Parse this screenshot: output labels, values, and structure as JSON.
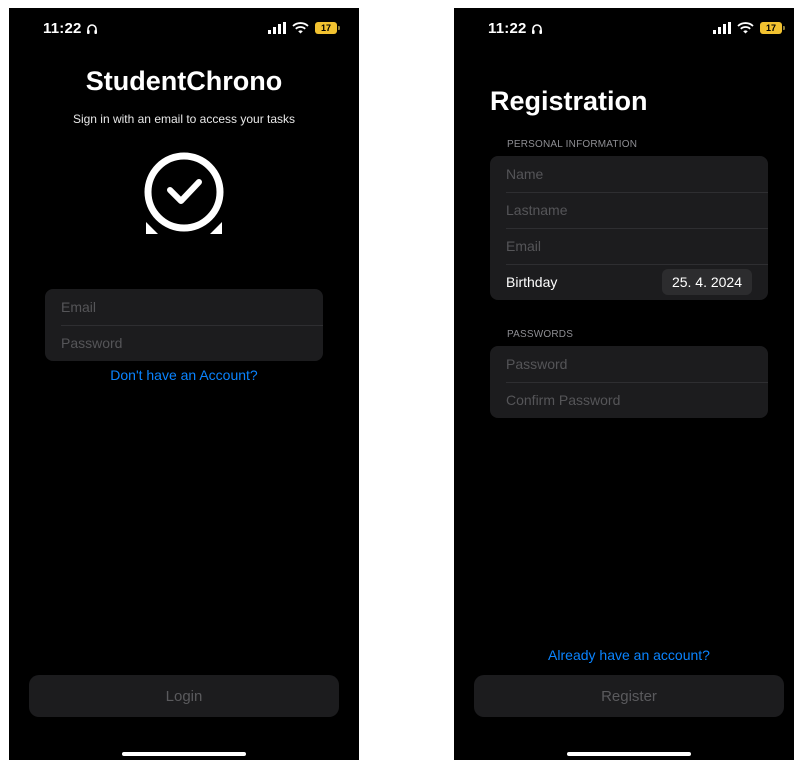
{
  "status": {
    "time": "11:22",
    "battery": "17"
  },
  "login": {
    "title": "StudentChrono",
    "subtitle": "Sign in with an email to access your tasks",
    "fields": {
      "email_placeholder": "Email",
      "password_placeholder": "Password"
    },
    "signup_link": "Don't have an Account?",
    "login_button": "Login"
  },
  "registration": {
    "title": "Registration",
    "personal_section": "PERSONAL INFORMATION",
    "fields": {
      "name_placeholder": "Name",
      "lastname_placeholder": "Lastname",
      "email_placeholder": "Email",
      "birthday_label": "Birthday",
      "birthday_value": "25. 4. 2024"
    },
    "passwords_section": "PASSWORDS",
    "password_fields": {
      "password_placeholder": "Password",
      "confirm_placeholder": "Confirm Password"
    },
    "login_link": "Already have an account?",
    "register_button": "Register"
  },
  "icons": [
    "headphones-icon",
    "signal-icon",
    "wifi-icon",
    "battery-icon",
    "clock-check-icon"
  ],
  "colors": {
    "background": "#000000",
    "field_bg": "#1c1c1e",
    "link": "#0a84ff",
    "battery": "#f2c230"
  }
}
